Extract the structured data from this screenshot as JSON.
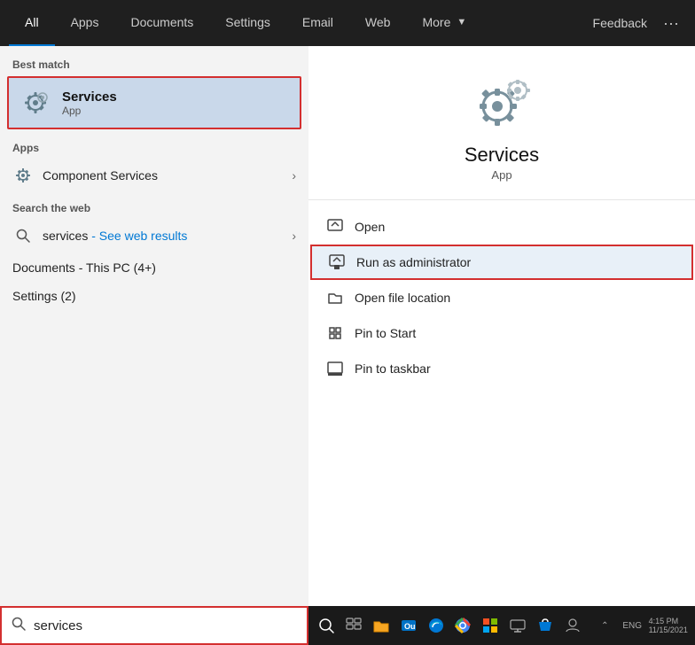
{
  "nav": {
    "tabs": [
      {
        "id": "all",
        "label": "All",
        "active": true
      },
      {
        "id": "apps",
        "label": "Apps",
        "active": false
      },
      {
        "id": "documents",
        "label": "Documents",
        "active": false
      },
      {
        "id": "settings",
        "label": "Settings",
        "active": false
      },
      {
        "id": "email",
        "label": "Email",
        "active": false
      },
      {
        "id": "web",
        "label": "Web",
        "active": false
      },
      {
        "id": "more",
        "label": "More",
        "active": false
      }
    ],
    "feedback_label": "Feedback",
    "dots_label": "···"
  },
  "left": {
    "best_match_label": "Best match",
    "best_match_name": "Services",
    "best_match_sub": "App",
    "apps_label": "Apps",
    "component_services_label": "Component Services",
    "search_web_label": "Search the web",
    "web_query": "services",
    "web_sub": "- See web results",
    "documents_label": "Documents - This PC (4+)",
    "settings_label": "Settings (2)"
  },
  "right": {
    "app_name": "Services",
    "app_sub": "App",
    "menu_items": [
      {
        "id": "open",
        "label": "Open"
      },
      {
        "id": "run-as-admin",
        "label": "Run as administrator",
        "highlighted": true
      },
      {
        "id": "open-file-location",
        "label": "Open file location"
      },
      {
        "id": "pin-to-start",
        "label": "Pin to Start"
      },
      {
        "id": "pin-to-taskbar",
        "label": "Pin to taskbar"
      }
    ]
  },
  "search_bar": {
    "value": "services",
    "placeholder": "services"
  },
  "taskbar": {
    "items": [
      "search",
      "task-view",
      "file-explorer",
      "outlook",
      "edge",
      "chrome",
      "photos",
      "remote",
      "store",
      "people"
    ]
  }
}
